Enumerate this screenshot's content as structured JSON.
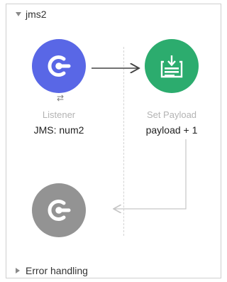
{
  "flow": {
    "name": "jms2",
    "expanded": true
  },
  "nodes": {
    "listener": {
      "type_label": "Listener",
      "value_label": "JMS: num2",
      "icon": "connector-plug-icon",
      "color": "#5967e6"
    },
    "set_payload": {
      "type_label": "Set Payload",
      "value_label": "payload + 1",
      "icon": "set-payload-icon",
      "color": "#2cac6e"
    },
    "source_return": {
      "icon": "connector-plug-icon",
      "color": "#939393"
    }
  },
  "listener_exchange_icon": "request-response-icon",
  "error_handling": {
    "label": "Error handling",
    "expanded": false
  }
}
